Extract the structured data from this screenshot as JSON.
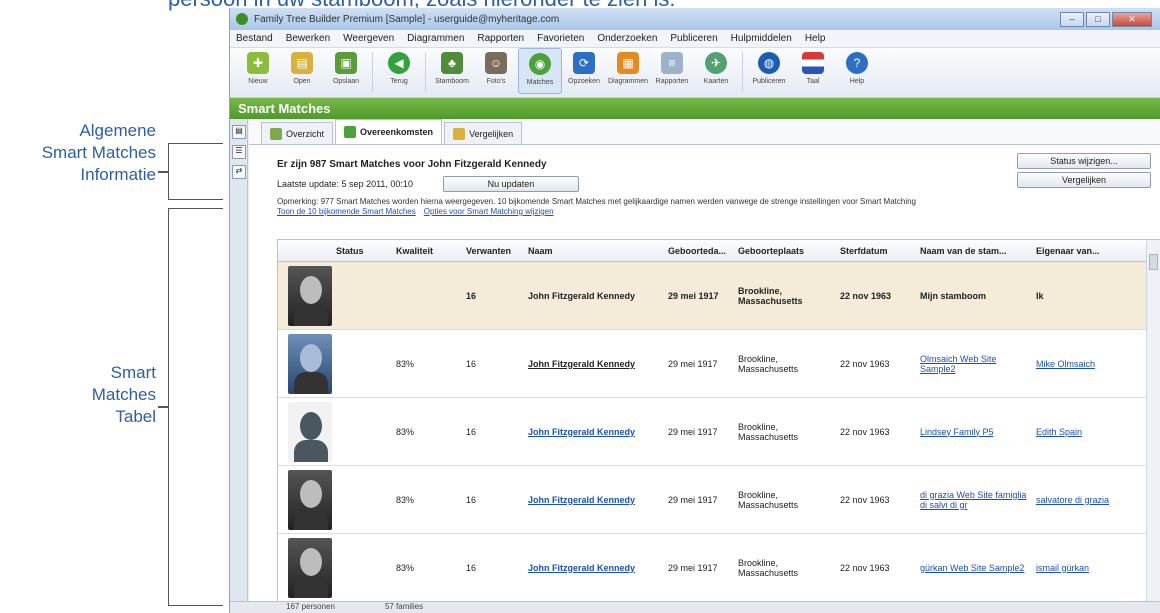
{
  "caption_cut": "persoon in uw stamboom, zoals hieronder te zien is.",
  "annotations": {
    "general_info": "Algemene\nSmart Matches\nInformatie",
    "table": "Smart\nMatches\nTabel"
  },
  "window": {
    "title": "Family Tree Builder Premium [Sample] - userguide@myheritage.com",
    "menu": [
      "Bestand",
      "Bewerken",
      "Weergeven",
      "Diagrammen",
      "Rapporten",
      "Favorieten",
      "Onderzoeken",
      "Publiceren",
      "Hulpmiddelen",
      "Help"
    ],
    "toolbar": [
      {
        "label": "Nieuw",
        "icon": "new-icon",
        "color": "#8cbc3e"
      },
      {
        "label": "Open",
        "icon": "open-icon",
        "color": "#d8b23a"
      },
      {
        "label": "Opslaan",
        "icon": "save-icon",
        "color": "#5d9a3a"
      },
      {
        "label": "Terug",
        "icon": "back-icon",
        "color": "#33a23a"
      },
      {
        "label": "Stamboom",
        "icon": "tree-icon",
        "color": "#4f8d3a"
      },
      {
        "label": "Foto's",
        "icon": "photos-icon",
        "color": "#7a6b5a"
      },
      {
        "label": "Matches",
        "icon": "matches-icon",
        "color": "#4ba23a"
      },
      {
        "label": "Opzoeken",
        "icon": "search-icon",
        "color": "#2d6fc2"
      },
      {
        "label": "Diagrammen",
        "icon": "charts-icon",
        "color": "#e58a1f"
      },
      {
        "label": "Rapporten",
        "icon": "reports-icon",
        "color": "#9fb2cc"
      },
      {
        "label": "Kaarten",
        "icon": "maps-icon",
        "color": "#53a070"
      },
      {
        "label": "Publiceren",
        "icon": "publish-icon",
        "color": "#1c5db3"
      },
      {
        "label": "Taal",
        "icon": "language-icon",
        "color": "#d83a3a"
      },
      {
        "label": "Help",
        "icon": "help-icon",
        "color": "#2d6fc2"
      }
    ],
    "section_title": "Smart Matches"
  },
  "tabs": [
    "Overzicht",
    "Overeenkomsten",
    "Vergelijken"
  ],
  "summary": {
    "heading": "Er zijn 987 Smart Matches voor John Fitzgerald Kennedy",
    "last_update": "Laatste update: 5 sep 2011, 00:10",
    "update_button": "Nu updaten",
    "status_button": "Status wijzigen...",
    "compare_button": "Vergelijken",
    "note": "Opmerking: 977 Smart Matches worden hierna weergegeven. 10 bijkomende Smart Matches met gelijkaardige namen werden vanwege de strenge instellingen voor Smart Matching",
    "link_show": "Toon de 10 bijkomende Smart Matches",
    "link_options": "Opties voor Smart Matching wijzigen"
  },
  "table": {
    "headers": [
      "",
      "Status",
      "Kwaliteit",
      "Verwanten",
      "Naam",
      "Geboorteda...",
      "Geboorteplaats",
      "Sterfdatum",
      "Naam van de stam...",
      "Eigenaar van..."
    ],
    "rows": [
      {
        "photo": "bw",
        "status": "",
        "quality": "",
        "relatives": "16",
        "name": "John Fitzgerald Kennedy",
        "birth": "29 mei 1917",
        "place": "Brookline, Massachusetts",
        "death": "22 nov 1963",
        "tree": "Mijn stamboom",
        "owner": "Ik"
      },
      {
        "photo": "blue",
        "status": "",
        "quality": "83%",
        "relatives": "16",
        "name": "John Fitzgerald Kennedy",
        "birth": "29 mei 1917",
        "place": "Brookline, Massachusetts",
        "death": "22 nov 1963",
        "tree": "Olmsaich Web Site Sample2",
        "owner": "Mike Olmsaich"
      },
      {
        "photo": "silhouette",
        "status": "",
        "quality": "83%",
        "relatives": "16",
        "name": "John Fitzgerald Kennedy",
        "birth": "29 mei 1917",
        "place": "Brookline, Massachusetts",
        "death": "22 nov 1963",
        "tree": "Lindsey Family P5",
        "owner": "Edith Spain"
      },
      {
        "photo": "bw",
        "status": "",
        "quality": "83%",
        "relatives": "16",
        "name": "John Fitzgerald Kennedy",
        "birth": "29 mei 1917",
        "place": "Brookline, Massachusetts",
        "death": "22 nov 1963",
        "tree": "di grazia Web Site famiglia di salvi di gr",
        "owner": "salvatore di grazia"
      },
      {
        "photo": "bw",
        "status": "",
        "quality": "83%",
        "relatives": "16",
        "name": "John Fitzgerald Kennedy",
        "birth": "29 mei 1917",
        "place": "Brookline, Massachusetts",
        "death": "22 nov 1963",
        "tree": "gürkan Web Site Sample2",
        "owner": "ismail gürkan"
      }
    ]
  },
  "statusbar": {
    "persons": "167 personen",
    "families": "57 families"
  }
}
